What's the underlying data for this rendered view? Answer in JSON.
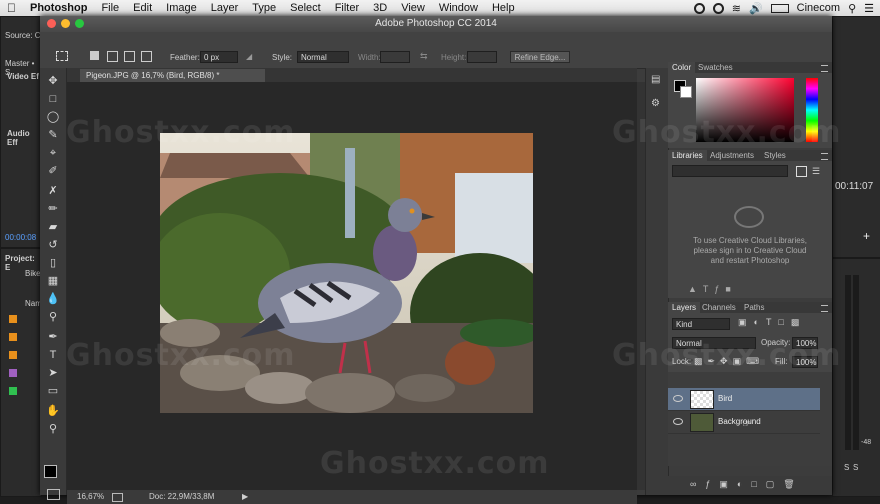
{
  "menubar": {
    "apple": "",
    "app": "Photoshop",
    "items": [
      "File",
      "Edit",
      "Image",
      "Layer",
      "Type",
      "Select",
      "Filter",
      "3D",
      "View",
      "Window",
      "Help"
    ],
    "user": "Cinecom"
  },
  "window": {
    "title": "Adobe Photoshop CC 2014"
  },
  "options": {
    "feather_label": "Feather:",
    "feather_value": "0 px",
    "style_label": "Style:",
    "style_value": "Normal",
    "width_label": "Width:",
    "height_label": "Height:",
    "refine_label": "Refine Edge..."
  },
  "document": {
    "tab_label": "Pigeon.JPG @ 16,7% (Bird, RGB/8) *",
    "zoom": "16,67%",
    "doc_info": "Doc: 22,9M/33,8M"
  },
  "color_panel": {
    "tabs": [
      "Color",
      "Swatches"
    ]
  },
  "libraries_panel": {
    "tabs": [
      "Libraries",
      "Adjustments",
      "Styles"
    ],
    "message": "To use Creative Cloud Libraries, please sign in to Creative Cloud and restart Photoshop"
  },
  "layers_panel": {
    "tabs": [
      "Layers",
      "Channels",
      "Paths"
    ],
    "kind": "Kind",
    "blend": "Normal",
    "opacity_label": "Opacity:",
    "opacity": "100%",
    "lock_label": "Lock:",
    "fill_label": "Fill:",
    "fill": "100%",
    "layers": [
      {
        "name": "Bird",
        "selected": true
      },
      {
        "name": "Background",
        "selected": false
      }
    ]
  },
  "bgapp": {
    "source": "Source: C",
    "master": "Master • S",
    "video_effects": "Video Ef",
    "audio_effects": "Audio Eff",
    "timecode": "00:00:08",
    "project": "Project: E",
    "bike": "Bike",
    "name_col": "Nam",
    "right_timecode": "00:11:07",
    "meter_values": [
      "-48",
      "S",
      "S"
    ]
  },
  "watermark": "Ghostxx.com",
  "colors": {
    "accent": "#5e7088",
    "panel": "#454545",
    "dark": "#282828"
  }
}
